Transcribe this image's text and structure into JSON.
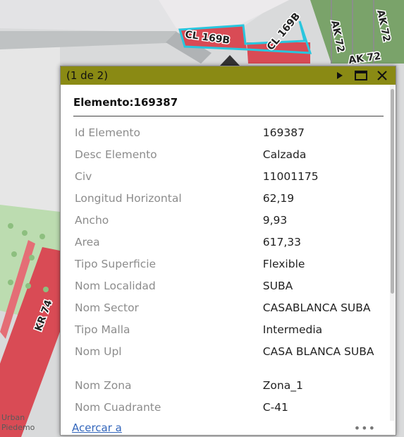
{
  "map": {
    "street_labels": [
      "CL 169B",
      "CL 169B",
      "AK 72",
      "AK 72",
      "AK 72",
      "KR 74"
    ],
    "corner_text": [
      "Urban",
      "Piedemo"
    ],
    "colors": {
      "road_fill": "#d94b55",
      "selected_outline": "#29c6de",
      "green_area": "#a8d39a",
      "background": "#d9dadb"
    }
  },
  "popup": {
    "counter": "(1 de 2)",
    "title": "Elemento:169387",
    "header_color": "#8a8a14",
    "buttons": {
      "next": "next-icon",
      "maximize": "maximize-icon",
      "close": "close-icon"
    },
    "attributes": [
      {
        "key": "Id Elemento",
        "value": "169387"
      },
      {
        "key": "Desc Elemento",
        "value": "Calzada"
      },
      {
        "key": "Civ",
        "value": "11001175"
      },
      {
        "key": "Longitud Horizontal",
        "value": "62,19"
      },
      {
        "key": "Ancho",
        "value": "9,93"
      },
      {
        "key": "Area",
        "value": "617,33"
      },
      {
        "key": "Tipo Superficie",
        "value": "Flexible"
      },
      {
        "key": "Nom Localidad",
        "value": "SUBA"
      },
      {
        "key": "Nom Sector",
        "value": "CASABLANCA SUBA"
      },
      {
        "key": "Tipo Malla",
        "value": "Intermedia"
      },
      {
        "key": "Nom Upl",
        "value": "CASA BLANCA SUBA"
      },
      {
        "key": "Nom Zona",
        "value": "Zona_1"
      },
      {
        "key": "Nom Cuadrante",
        "value": "C-41"
      }
    ],
    "zoom_link": "Acercar a",
    "more": "•••"
  }
}
